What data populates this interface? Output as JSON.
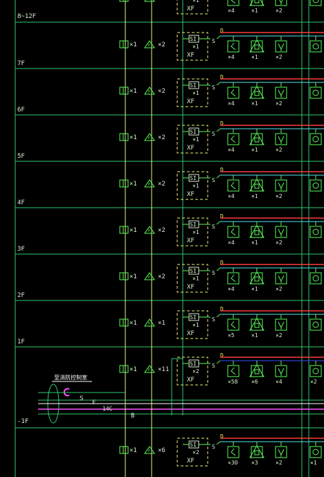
{
  "drawing": {
    "colors": {
      "background": "#000000",
      "floor_line": "#2ecc71",
      "symbol": "#5dfc5d",
      "label": "#d8f0d0",
      "riser": "#e8f87a",
      "yellow_text": "#f2f25c",
      "red_bus": "#ff3b3b",
      "cyan_bus": "#58e8f0",
      "blue_bus": "#3a4cff",
      "magenta": "#ff55ff",
      "white": "#ffffff",
      "dashed_box": "#f0f07a"
    },
    "floors": [
      {
        "label": "8~12F",
        "smoke_count": "×1",
        "manual_count": "×2",
        "module_count": "×1",
        "items": [
          {
            "icon": "smoke-detector-icon",
            "count": "×4"
          },
          {
            "icon": "alarm-bell-icon",
            "count": "×1"
          },
          {
            "icon": "speaker-icon",
            "count": "×2"
          },
          {
            "icon": "hydrant-button-icon",
            "count": ""
          }
        ]
      },
      {
        "label": "7F",
        "smoke_count": "×1",
        "manual_count": "×2",
        "module_count": "×1",
        "items": [
          {
            "icon": "smoke-detector-icon",
            "count": "×4"
          },
          {
            "icon": "alarm-bell-icon",
            "count": "×1"
          },
          {
            "icon": "speaker-icon",
            "count": "×2"
          },
          {
            "icon": "hydrant-button-icon",
            "count": ""
          }
        ]
      },
      {
        "label": "6F",
        "smoke_count": "×1",
        "manual_count": "×2",
        "module_count": "×1",
        "items": [
          {
            "icon": "smoke-detector-icon",
            "count": "×4"
          },
          {
            "icon": "alarm-bell-icon",
            "count": "×1"
          },
          {
            "icon": "speaker-icon",
            "count": "×2"
          },
          {
            "icon": "hydrant-button-icon",
            "count": ""
          }
        ]
      },
      {
        "label": "5F",
        "smoke_count": "×1",
        "manual_count": "×2",
        "module_count": "×1",
        "items": [
          {
            "icon": "smoke-detector-icon",
            "count": "×4"
          },
          {
            "icon": "alarm-bell-icon",
            "count": "×1"
          },
          {
            "icon": "speaker-icon",
            "count": "×2"
          },
          {
            "icon": "hydrant-button-icon",
            "count": ""
          }
        ]
      },
      {
        "label": "4F",
        "smoke_count": "×1",
        "manual_count": "×2",
        "module_count": "×1",
        "items": [
          {
            "icon": "smoke-detector-icon",
            "count": "×4"
          },
          {
            "icon": "alarm-bell-icon",
            "count": "×1"
          },
          {
            "icon": "speaker-icon",
            "count": "×2"
          },
          {
            "icon": "hydrant-button-icon",
            "count": ""
          }
        ]
      },
      {
        "label": "3F",
        "smoke_count": "×1",
        "manual_count": "×2",
        "module_count": "×1",
        "items": [
          {
            "icon": "smoke-detector-icon",
            "count": "×4"
          },
          {
            "icon": "alarm-bell-icon",
            "count": "×1"
          },
          {
            "icon": "speaker-icon",
            "count": "×2"
          },
          {
            "icon": "hydrant-button-icon",
            "count": ""
          }
        ]
      },
      {
        "label": "2F",
        "smoke_count": "×1",
        "manual_count": "×2",
        "module_count": "×1",
        "items": [
          {
            "icon": "smoke-detector-icon",
            "count": "×4"
          },
          {
            "icon": "alarm-bell-icon",
            "count": "×1"
          },
          {
            "icon": "speaker-icon",
            "count": "×2"
          },
          {
            "icon": "hydrant-button-icon",
            "count": ""
          }
        ]
      },
      {
        "label": "1F",
        "smoke_count": "×1",
        "manual_count": "×1",
        "module_count": "×1",
        "items": [
          {
            "icon": "smoke-detector-icon",
            "count": "×5"
          },
          {
            "icon": "alarm-bell-icon",
            "count": "×1"
          },
          {
            "icon": "speaker-icon",
            "count": "×2"
          },
          {
            "icon": "hydrant-button-icon",
            "count": ""
          }
        ]
      },
      {
        "label": "-1F",
        "smoke_count": "×1",
        "manual_count": "×11",
        "module_count": "×2",
        "items": [
          {
            "icon": "smoke-detector-icon",
            "count": "×58"
          },
          {
            "icon": "alarm-bell-icon",
            "count": "×6"
          },
          {
            "icon": "speaker-icon",
            "count": "×4"
          },
          {
            "icon": "hydrant-button-icon",
            "count": "×2"
          }
        ]
      },
      {
        "label": "",
        "smoke_count": "×1",
        "manual_count": "×6",
        "module_count": "×2",
        "items": [
          {
            "icon": "smoke-detector-icon",
            "count": "×30"
          },
          {
            "icon": "alarm-bell-icon",
            "count": "×3"
          },
          {
            "icon": "speaker-icon",
            "count": "×2"
          },
          {
            "icon": "hydrant-button-icon",
            "count": "×1"
          }
        ]
      }
    ],
    "module_text": {
      "si": "SI",
      "xf": "XF",
      "s": "S",
      "d": "D",
      "f": "F"
    },
    "control_room": {
      "label": "至消防控制室",
      "s": "S",
      "f": "F",
      "c": "14C",
      "b": "B"
    }
  }
}
